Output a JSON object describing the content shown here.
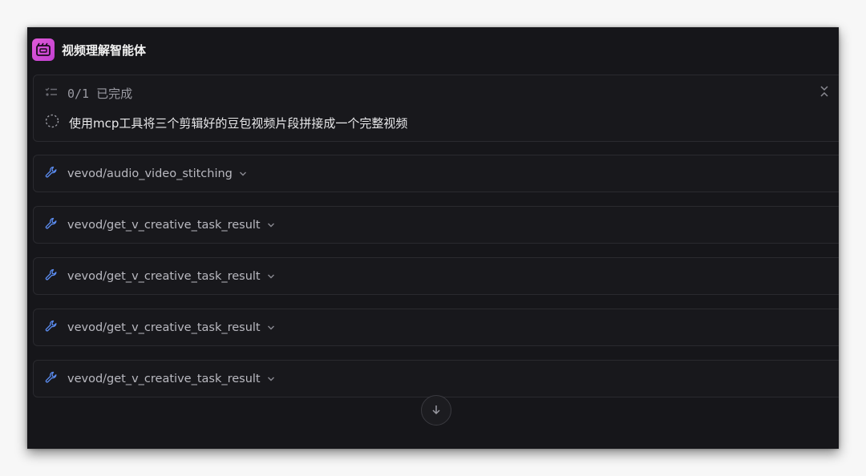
{
  "app": {
    "title": "视频理解智能体",
    "accent_color": "#d34bd6",
    "icon": "video-agent-icon"
  },
  "task_card": {
    "progress": "0/1 已完成",
    "progress_icon": "checklist-icon",
    "collapse_icon": "collapse-icon",
    "task": {
      "text": "使用mcp工具将三个剪辑好的豆包视频片段拼接成一个完整视频",
      "status_icon": "pending-spinner-icon"
    }
  },
  "tool_calls": [
    {
      "label": "vevod/audio_video_stitching",
      "icon": "wrench-icon"
    },
    {
      "label": "vevod/get_v_creative_task_result",
      "icon": "wrench-icon"
    },
    {
      "label": "vevod/get_v_creative_task_result",
      "icon": "wrench-icon"
    },
    {
      "label": "vevod/get_v_creative_task_result",
      "icon": "wrench-icon"
    },
    {
      "label": "vevod/get_v_creative_task_result",
      "icon": "wrench-icon"
    }
  ],
  "scroll_button": {
    "icon": "arrow-down-icon"
  }
}
